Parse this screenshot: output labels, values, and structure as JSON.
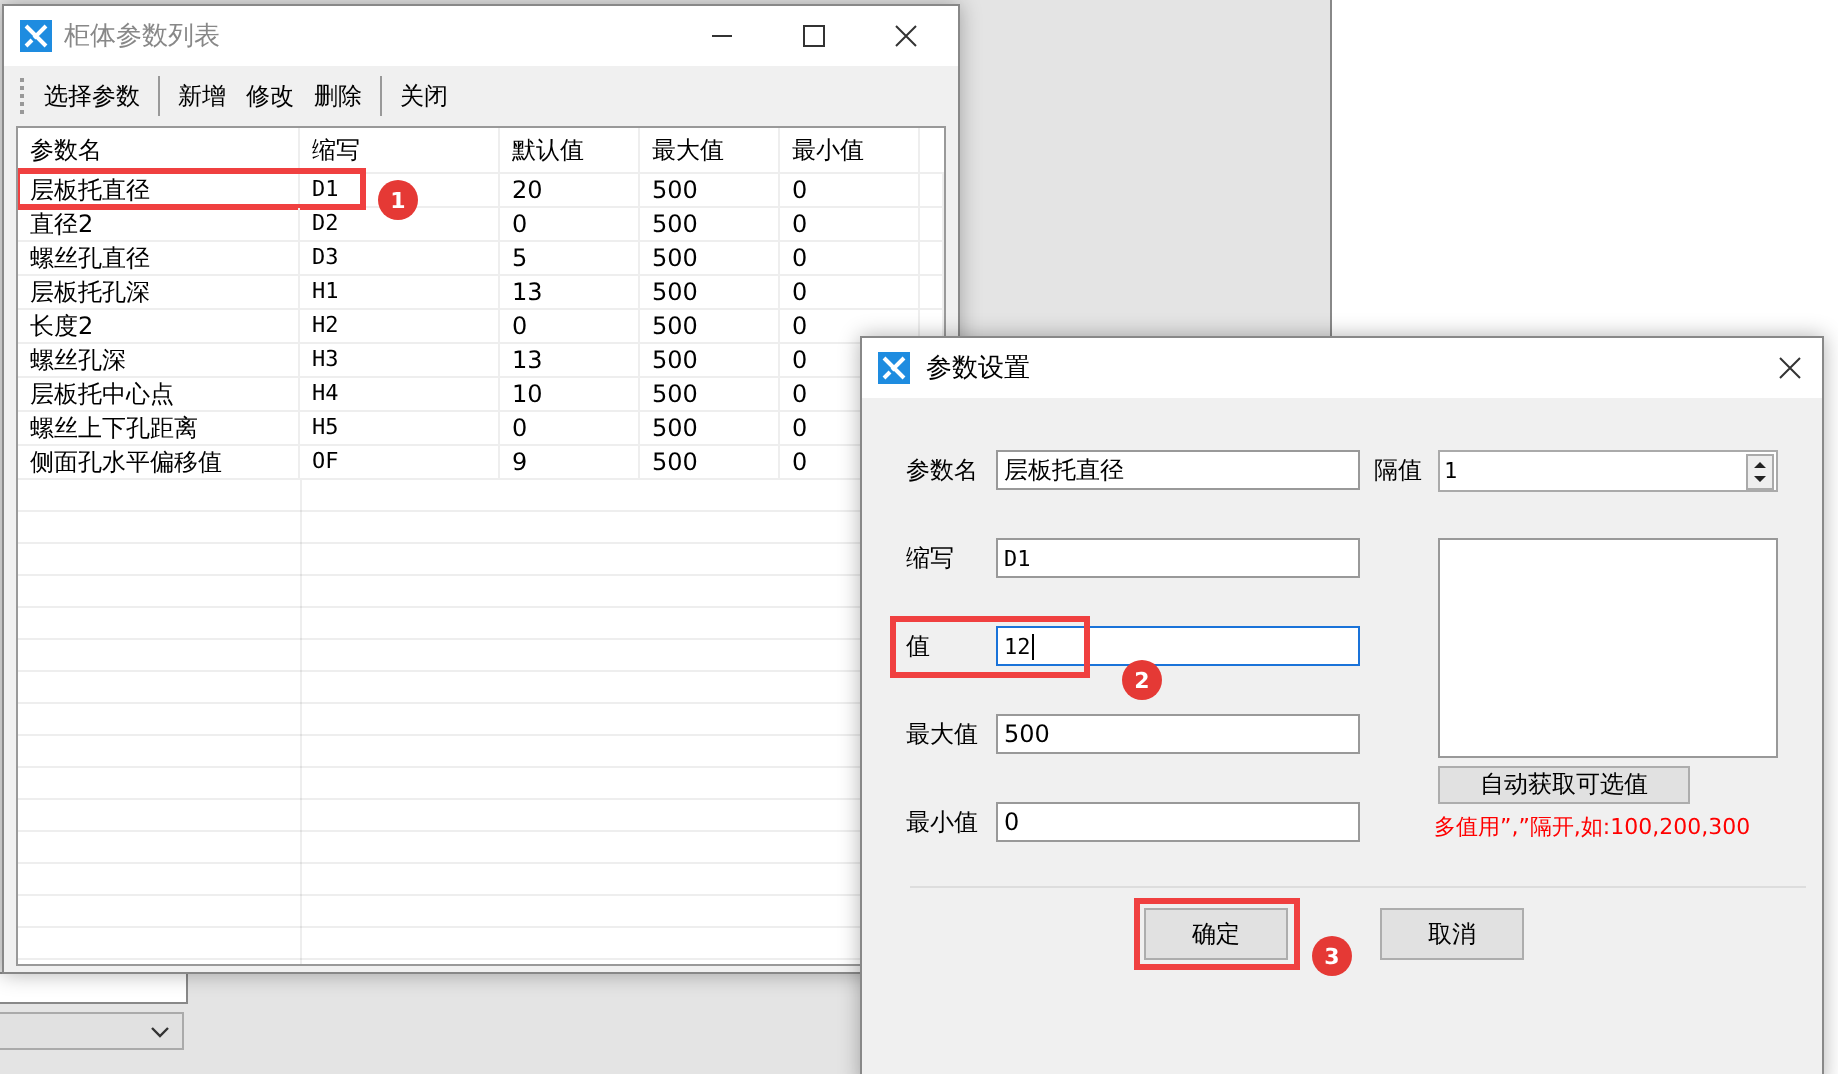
{
  "list_window": {
    "title": "柜体参数列表",
    "toolbar_groups": [
      [
        "选择参数"
      ],
      [
        "新增",
        "修改",
        "删除"
      ],
      [
        "关闭"
      ]
    ],
    "table": {
      "columns": [
        "参数名",
        "缩写",
        "默认值",
        "最大值",
        "最小值"
      ],
      "rows": [
        {
          "cells": [
            "层板托直径",
            "D1",
            "20",
            "500",
            "0"
          ],
          "callout": "1"
        },
        {
          "cells": [
            "直径2",
            "D2",
            "0",
            "500",
            "0"
          ]
        },
        {
          "cells": [
            "螺丝孔直径",
            "D3",
            "5",
            "500",
            "0"
          ]
        },
        {
          "cells": [
            "层板托孔深",
            "H1",
            "13",
            "500",
            "0"
          ]
        },
        {
          "cells": [
            "长度2",
            "H2",
            "0",
            "500",
            "0"
          ]
        },
        {
          "cells": [
            "螺丝孔深",
            "H3",
            "13",
            "500",
            "0"
          ]
        },
        {
          "cells": [
            "层板托中心点",
            "H4",
            "10",
            "500",
            "0"
          ]
        },
        {
          "cells": [
            "螺丝上下孔距离",
            "H5",
            "0",
            "500",
            "0"
          ]
        },
        {
          "cells": [
            "侧面孔水平偏移值",
            "OF",
            "9",
            "500",
            "0"
          ]
        }
      ]
    }
  },
  "dialog": {
    "title": "参数设置",
    "fields": [
      {
        "label": "参数名",
        "value": "层板托直径",
        "focused": false
      },
      {
        "label": "缩写",
        "value": "D1",
        "focused": false
      },
      {
        "label": "值",
        "value": "12",
        "focused": true,
        "callout": "2"
      },
      {
        "label": "最大值",
        "value": "500",
        "focused": false
      },
      {
        "label": "最小值",
        "value": "0",
        "focused": false
      }
    ],
    "interval": {
      "label": "隔值",
      "value": "1"
    },
    "auto_button": "自动获取可选值",
    "hint": "多值用”,”隔开,如:100,200,300",
    "buttons": [
      {
        "label": "确定",
        "callout": "3"
      },
      {
        "label": "取消"
      }
    ]
  }
}
